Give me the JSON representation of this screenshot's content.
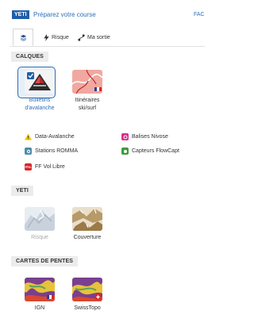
{
  "header": {
    "badge": "YETI",
    "title": "Préparez votre course",
    "faq": "FAC"
  },
  "tabs": [
    {
      "label": ""
    },
    {
      "label": "Risque"
    },
    {
      "label": "Ma sortie"
    }
  ],
  "sections": {
    "calques": "CALQUES",
    "yeti": "YETI",
    "cartes": "CARTES DE PENTES"
  },
  "calques_tiles": [
    {
      "caption_line1": "Bulletins",
      "caption_line2": "d'avalanche",
      "selected": true
    },
    {
      "caption_line1": "Itinéraires",
      "caption_line2": "ski/surf",
      "selected": false
    }
  ],
  "legend": [
    {
      "label": "Data-Avalanche",
      "color": "#f2c300",
      "icon": "warning-icon"
    },
    {
      "label": "Balises Nivose",
      "color": "#e0288a",
      "icon": "beacon-icon"
    },
    {
      "label": "Stations ROMMA",
      "color": "#4a8ea8",
      "icon": "station-icon"
    },
    {
      "label": "Capteurs FlowCapt",
      "color": "#3e9a3e",
      "icon": "sensor-icon"
    },
    {
      "label": "FF Vol Libre",
      "color": "#d9252a",
      "icon": "paraglide-icon",
      "icon_text": "FFVL"
    }
  ],
  "yeti_tiles": [
    {
      "caption": "Risque",
      "disabled": true
    },
    {
      "caption": "Couverture",
      "disabled": false
    }
  ],
  "slope_tiles": [
    {
      "caption": "IGN",
      "flag": "france"
    },
    {
      "caption": "SwissTopo",
      "flag": "switzerland"
    }
  ],
  "colors": {
    "accent": "#2e6fb5",
    "badge": "#1f5fa8",
    "section_bg": "#ececec"
  }
}
